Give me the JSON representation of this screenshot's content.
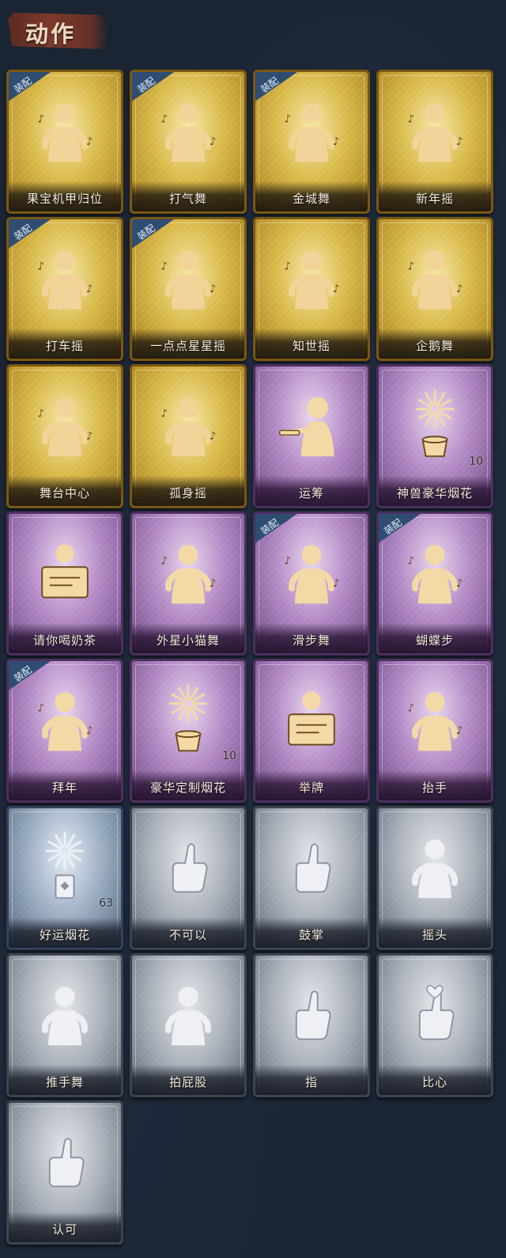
{
  "section": {
    "title": "动作"
  },
  "badge_text": "装配",
  "cards": [
    {
      "label": "果宝机甲归位",
      "rarity": "gold",
      "equipped": true,
      "icon": "robot-pose-icon"
    },
    {
      "label": "打气舞",
      "rarity": "gold",
      "equipped": true,
      "icon": "dance-figure-icon"
    },
    {
      "label": "金城舞",
      "rarity": "gold",
      "equipped": true,
      "icon": "dance-figure-icon"
    },
    {
      "label": "新年摇",
      "rarity": "gold",
      "equipped": false,
      "icon": "dance-figure-icon"
    },
    {
      "label": "打车摇",
      "rarity": "gold",
      "equipped": true,
      "icon": "dance-figure-icon"
    },
    {
      "label": "一点点星星摇",
      "rarity": "gold",
      "equipped": true,
      "icon": "dance-figure-icon"
    },
    {
      "label": "知世摇",
      "rarity": "gold",
      "equipped": false,
      "icon": "dance-figure-icon"
    },
    {
      "label": "企鹅舞",
      "rarity": "gold",
      "equipped": false,
      "icon": "dance-figure-icon"
    },
    {
      "label": "舞台中心",
      "rarity": "gold",
      "equipped": false,
      "icon": "dance-figure-icon"
    },
    {
      "label": "孤身摇",
      "rarity": "gold",
      "equipped": false,
      "icon": "dance-figure-icon"
    },
    {
      "label": "运筹",
      "rarity": "purple",
      "equipped": false,
      "icon": "strategist-figure-icon"
    },
    {
      "label": "神兽豪华烟花",
      "rarity": "purple",
      "equipped": false,
      "icon": "firework-icon",
      "count": "10"
    },
    {
      "label": "请你喝奶茶",
      "rarity": "purple",
      "equipped": false,
      "icon": "milk-tea-sign-icon"
    },
    {
      "label": "外星小猫舞",
      "rarity": "purple",
      "equipped": false,
      "icon": "dance-figure-icon"
    },
    {
      "label": "滑步舞",
      "rarity": "purple",
      "equipped": true,
      "icon": "dance-figure-icon"
    },
    {
      "label": "蝴蝶步",
      "rarity": "purple",
      "equipped": true,
      "icon": "dance-figure-icon"
    },
    {
      "label": "拜年",
      "rarity": "purple",
      "equipped": true,
      "icon": "bow-figure-icon"
    },
    {
      "label": "豪华定制烟花",
      "rarity": "purple",
      "equipped": false,
      "icon": "firework-icon",
      "count": "10"
    },
    {
      "label": "举牌",
      "rarity": "purple",
      "equipped": false,
      "icon": "sign-holder-icon"
    },
    {
      "label": "抬手",
      "rarity": "purple",
      "equipped": false,
      "icon": "raise-hand-icon"
    },
    {
      "label": "好运烟花",
      "rarity": "blue",
      "equipped": false,
      "icon": "firework-can-icon",
      "count": "63"
    },
    {
      "label": "不可以",
      "rarity": "grey",
      "equipped": false,
      "icon": "finger-no-icon"
    },
    {
      "label": "鼓掌",
      "rarity": "grey",
      "equipped": false,
      "icon": "clap-icon"
    },
    {
      "label": "摇头",
      "rarity": "grey",
      "equipped": false,
      "icon": "shake-head-icon"
    },
    {
      "label": "推手舞",
      "rarity": "grey",
      "equipped": false,
      "icon": "push-hands-icon"
    },
    {
      "label": "拍屁股",
      "rarity": "grey",
      "equipped": false,
      "icon": "slap-figure-icon"
    },
    {
      "label": "指",
      "rarity": "grey",
      "equipped": false,
      "icon": "point-hand-icon"
    },
    {
      "label": "比心",
      "rarity": "grey",
      "equipped": false,
      "icon": "heart-hands-icon"
    },
    {
      "label": "认可",
      "rarity": "grey",
      "equipped": false,
      "icon": "thumbs-up-icon"
    }
  ],
  "colors": {
    "gold_art": "#f2d49a",
    "purple_art": "#f3d9a6",
    "grey_art": "#eef0f4",
    "badge_bg": "#2f4d72",
    "title_banner": "#7c3a2c"
  }
}
